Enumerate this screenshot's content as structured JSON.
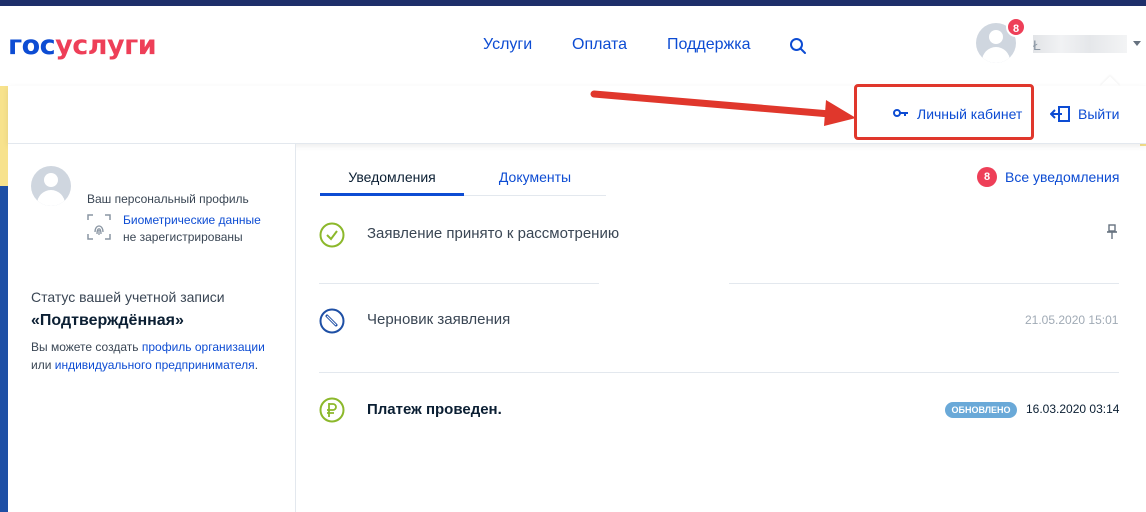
{
  "header": {
    "logo_gos": "гос",
    "logo_uslugi": "услуги",
    "nav": {
      "services": "Услуги",
      "payment": "Оплата",
      "support": "Поддержка"
    },
    "notification_count": "8",
    "user_initial": "Ł"
  },
  "dropdown": {
    "cabinet_label": "Личный кабинет",
    "logout_label": "Выйти"
  },
  "profile": {
    "caption": "Ваш персональный профиль",
    "biometric_link": "Биометрические данные",
    "biometric_status": "не зарегистрированы",
    "account_status_caption": "Статус вашей учетной записи",
    "account_status_value": "«Подтверждённая»",
    "hint_prefix": "Вы можете создать",
    "hint_org_link": "профиль организации",
    "hint_or": "или",
    "hint_ip_link": "индивидуального предпринимателя",
    "hint_suffix": "."
  },
  "tabs": {
    "notifications": "Уведомления",
    "documents": "Документы"
  },
  "all_notifications": {
    "count": "8",
    "label": "Все уведомления"
  },
  "notifications": [
    {
      "title": "Заявление принято к рассмотрению",
      "date": "",
      "icon": "check-circle-icon",
      "pinned": true
    },
    {
      "title": "Черновик заявления",
      "date": "21.05.2020 15:01",
      "icon": "pencil-circle-icon"
    },
    {
      "title": "Платеж проведен.",
      "date": "16.03.2020 03:14",
      "icon": "ruble-circle-icon",
      "badge": "ОБНОВЛЕНО"
    }
  ],
  "colors": {
    "brand_blue": "#0d4cd3",
    "brand_red": "#ee3f58",
    "highlight": "#e0372c",
    "badge_updated": "#6aa9d8"
  }
}
